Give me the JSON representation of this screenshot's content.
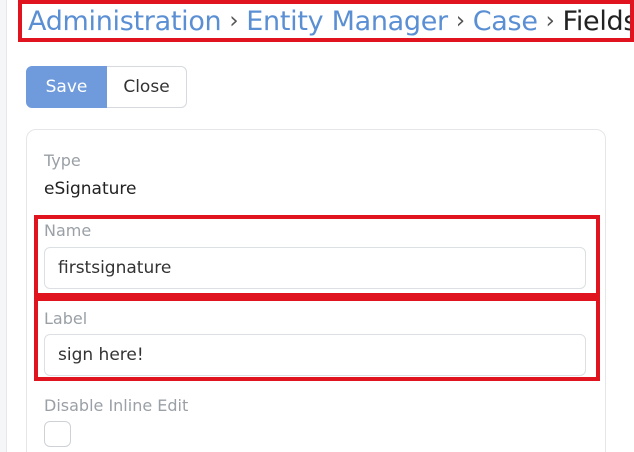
{
  "breadcrumb": {
    "items": [
      "Administration",
      "Entity Manager",
      "Case"
    ],
    "separator": "›",
    "current": "Fields"
  },
  "toolbar": {
    "save_label": "Save",
    "close_label": "Close"
  },
  "form": {
    "type": {
      "label": "Type",
      "value": "eSignature"
    },
    "name": {
      "label": "Name",
      "value": "firstsignature"
    },
    "label": {
      "label": "Label",
      "value": "sign here!"
    },
    "disable_inline_edit": {
      "label": "Disable Inline Edit",
      "checked": false
    }
  },
  "colors": {
    "accent": "#6f9bdc",
    "link": "#5b8fd4",
    "highlight": "#e0141e"
  }
}
